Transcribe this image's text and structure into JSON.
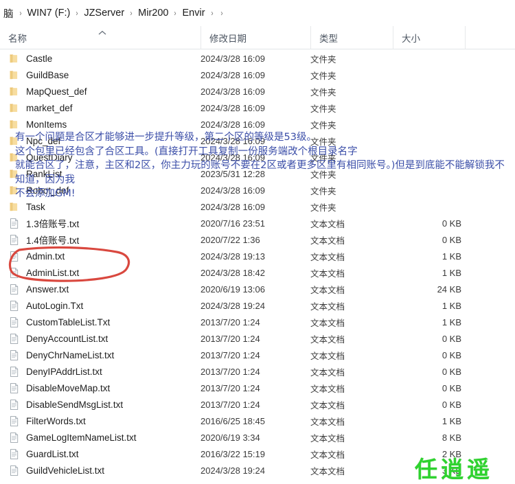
{
  "breadcrumb": {
    "items": [
      "脑",
      "WIN7 (F:)",
      "JZServer",
      "Mir200",
      "Envir",
      ""
    ],
    "separator": "›"
  },
  "columns": {
    "name": "名称",
    "modified": "修改日期",
    "type": "类型",
    "size": "大小",
    "sort_indicator": "︿"
  },
  "types": {
    "folder": "文件夹",
    "text": "文本文档"
  },
  "icons": {
    "folder": "folder-icon",
    "text_file": "text-file-icon"
  },
  "rows": [
    {
      "name": "Castle",
      "kind": "folder",
      "date": "2024/3/28 16:09",
      "type": "文件夹",
      "size": ""
    },
    {
      "name": "GuildBase",
      "kind": "folder",
      "date": "2024/3/28 16:09",
      "type": "文件夹",
      "size": ""
    },
    {
      "name": "MapQuest_def",
      "kind": "folder",
      "date": "2024/3/28 16:09",
      "type": "文件夹",
      "size": ""
    },
    {
      "name": "market_def",
      "kind": "folder",
      "date": "2024/3/28 16:09",
      "type": "文件夹",
      "size": ""
    },
    {
      "name": "MonItems",
      "kind": "folder",
      "date": "2024/3/28 16:09",
      "type": "文件夹",
      "size": ""
    },
    {
      "name": "Npc_def",
      "kind": "folder",
      "date": "2024/3/28 16:09",
      "type": "文件夹",
      "size": ""
    },
    {
      "name": "QuestDiary",
      "kind": "folder",
      "date": "2024/3/28 16:09",
      "type": "文件夹",
      "size": ""
    },
    {
      "name": "RankList",
      "kind": "folder",
      "date": "2023/5/31 12:28",
      "type": "文件夹",
      "size": ""
    },
    {
      "name": "Robot_def",
      "kind": "folder",
      "date": "2024/3/28 16:09",
      "type": "文件夹",
      "size": ""
    },
    {
      "name": "Task",
      "kind": "folder",
      "date": "2024/3/28 16:09",
      "type": "文件夹",
      "size": ""
    },
    {
      "name": "1.3倍账号.txt",
      "kind": "text",
      "date": "2020/7/16 23:51",
      "type": "文本文档",
      "size": "0 KB"
    },
    {
      "name": "1.4倍账号.txt",
      "kind": "text",
      "date": "2020/7/22 1:36",
      "type": "文本文档",
      "size": "0 KB"
    },
    {
      "name": "Admin.txt",
      "kind": "text",
      "date": "2024/3/28 19:13",
      "type": "文本文档",
      "size": "1 KB"
    },
    {
      "name": "AdminList.txt",
      "kind": "text",
      "date": "2024/3/28 18:42",
      "type": "文本文档",
      "size": "1 KB"
    },
    {
      "name": "Answer.txt",
      "kind": "text",
      "date": "2020/6/19 13:06",
      "type": "文本文档",
      "size": "24 KB"
    },
    {
      "name": "AutoLogin.Txt",
      "kind": "text",
      "date": "2024/3/28 19:24",
      "type": "文本文档",
      "size": "1 KB"
    },
    {
      "name": "CustomTableList.Txt",
      "kind": "text",
      "date": "2013/7/20 1:24",
      "type": "文本文档",
      "size": "1 KB"
    },
    {
      "name": "DenyAccountList.txt",
      "kind": "text",
      "date": "2013/7/20 1:24",
      "type": "文本文档",
      "size": "0 KB"
    },
    {
      "name": "DenyChrNameList.txt",
      "kind": "text",
      "date": "2013/7/20 1:24",
      "type": "文本文档",
      "size": "0 KB"
    },
    {
      "name": "DenyIPAddrList.txt",
      "kind": "text",
      "date": "2013/7/20 1:24",
      "type": "文本文档",
      "size": "0 KB"
    },
    {
      "name": "DisableMoveMap.txt",
      "kind": "text",
      "date": "2013/7/20 1:24",
      "type": "文本文档",
      "size": "0 KB"
    },
    {
      "name": "DisableSendMsgList.txt",
      "kind": "text",
      "date": "2013/7/20 1:24",
      "type": "文本文档",
      "size": "0 KB"
    },
    {
      "name": "FilterWords.txt",
      "kind": "text",
      "date": "2016/6/25 18:45",
      "type": "文本文档",
      "size": "1 KB"
    },
    {
      "name": "GameLogItemNameList.txt",
      "kind": "text",
      "date": "2020/6/19 3:34",
      "type": "文本文档",
      "size": "8 KB"
    },
    {
      "name": "GuardList.txt",
      "kind": "text",
      "date": "2016/3/22 15:19",
      "type": "文本文档",
      "size": "2 KB"
    },
    {
      "name": "GuildVehicleList.txt",
      "kind": "text",
      "date": "2024/3/28 19:24",
      "type": "文本文档",
      "size": "3 KB"
    }
  ],
  "annotation": {
    "color": "#3b4ea8",
    "lines": [
      "有一个问题是合区才能够进一步提升等级，第二个区的等级是53级。",
      "这个包里已经包含了合区工具。(直接打开工具复制一份服务端改个根目录名字",
      "就能合区了，注意，主区和2区，你主力玩的账号不要在2区或者更多区里有相同账号。)但是到底能不能解锁我不",
      "知道，因为我",
      "不会添加GM!"
    ]
  },
  "watermark": {
    "text": "任逍遥",
    "color": "#2fd22f"
  },
  "highlight": {
    "color": "#d9483f",
    "targets": [
      "Admin.txt",
      "AdminList.txt"
    ]
  }
}
